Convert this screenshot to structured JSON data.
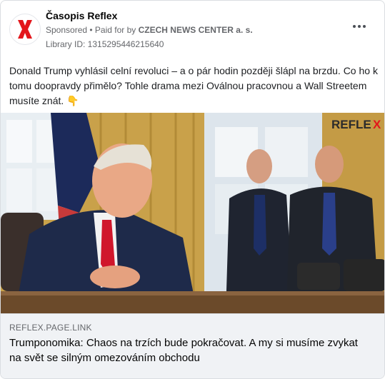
{
  "post": {
    "page_name": "Časopis Reflex",
    "sponsored": "Sponsored",
    "paid_for_prefix": "• Paid for by",
    "payer": "CZECH NEWS CENTER a. s.",
    "library_id": "Library ID: 1315295446215640",
    "body": "Donald Trump vyhlásil celní revoluci – a o pár hodin později šlápl na brzdu. Co ho k tomu doopravdy přimělo? Tohle drama mezi Oválnou pracovnou a Wall Streetem musíte znát. 👇"
  },
  "media": {
    "watermark_parts": [
      "REFLE",
      "X"
    ]
  },
  "link": {
    "domain": "REFLEX.PAGE.LINK",
    "headline": "Trumponomika: Chaos na trzích bude pokračovat. A my si musíme zvykat na svět se silným omezováním obchodu"
  },
  "colors": {
    "brand_red": "#e3161b",
    "muted": "#65676b",
    "footer_bg": "#f0f2f5"
  },
  "icons": {
    "avatar": "reflex-x-logo",
    "more": "more-horizontal-icon"
  }
}
